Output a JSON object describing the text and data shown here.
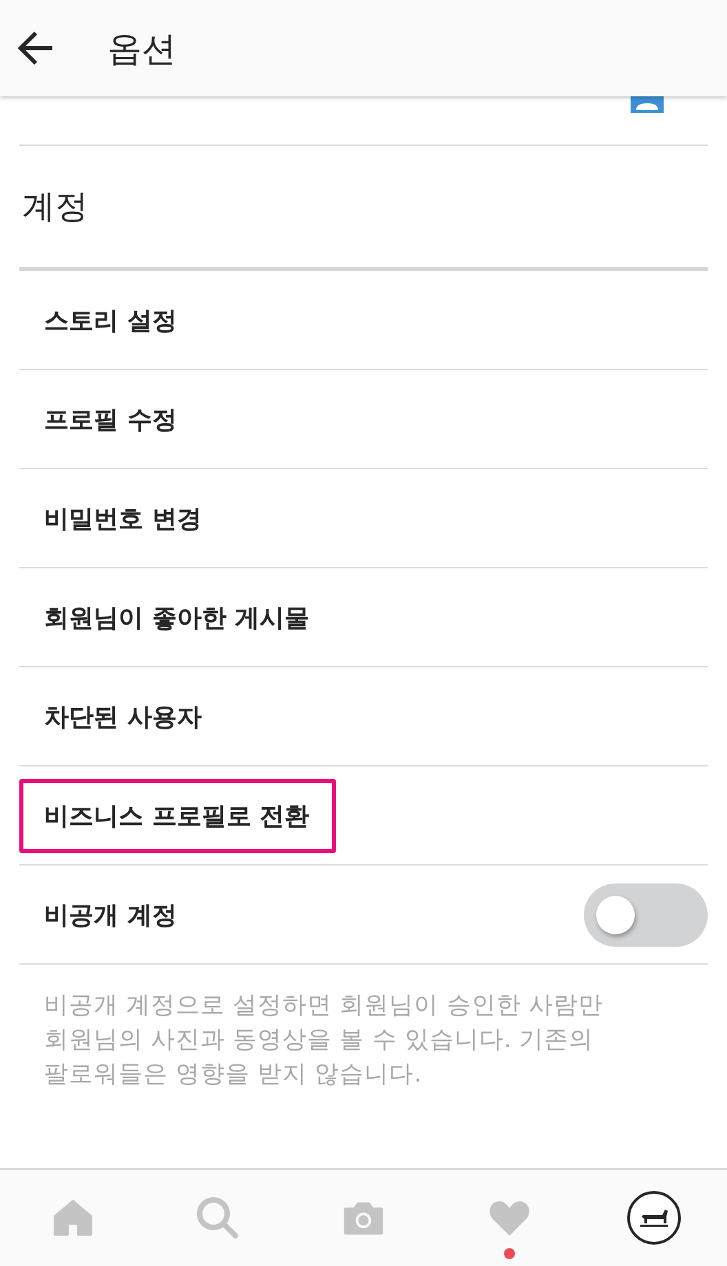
{
  "header": {
    "title": "옵션"
  },
  "section": {
    "title": "계정"
  },
  "items": [
    {
      "kind": "link",
      "label": "스토리 설정",
      "highlighted": false
    },
    {
      "kind": "link",
      "label": "프로필 수정",
      "highlighted": false
    },
    {
      "kind": "link",
      "label": "비밀번호 변경",
      "highlighted": false
    },
    {
      "kind": "link",
      "label": "회원님이 좋아한 게시물",
      "highlighted": false
    },
    {
      "kind": "link",
      "label": "차단된 사용자",
      "highlighted": false
    },
    {
      "kind": "link",
      "label": "비즈니스 프로필로 전환",
      "highlighted": true
    },
    {
      "kind": "toggle",
      "label": "비공개 계정",
      "on": false
    }
  ],
  "note": "비공개 계정으로 설정하면 회원님이 승인한 사람만 회원님의 사진과 동영상을 볼 수 있습니다. 기존의 팔로워들은 영향을 받지 않습니다.",
  "nav": [
    {
      "kind": "home",
      "badge": false
    },
    {
      "kind": "search",
      "badge": false
    },
    {
      "kind": "camera",
      "badge": false
    },
    {
      "kind": "heart",
      "badge": true
    },
    {
      "kind": "profile",
      "badge": false
    }
  ]
}
